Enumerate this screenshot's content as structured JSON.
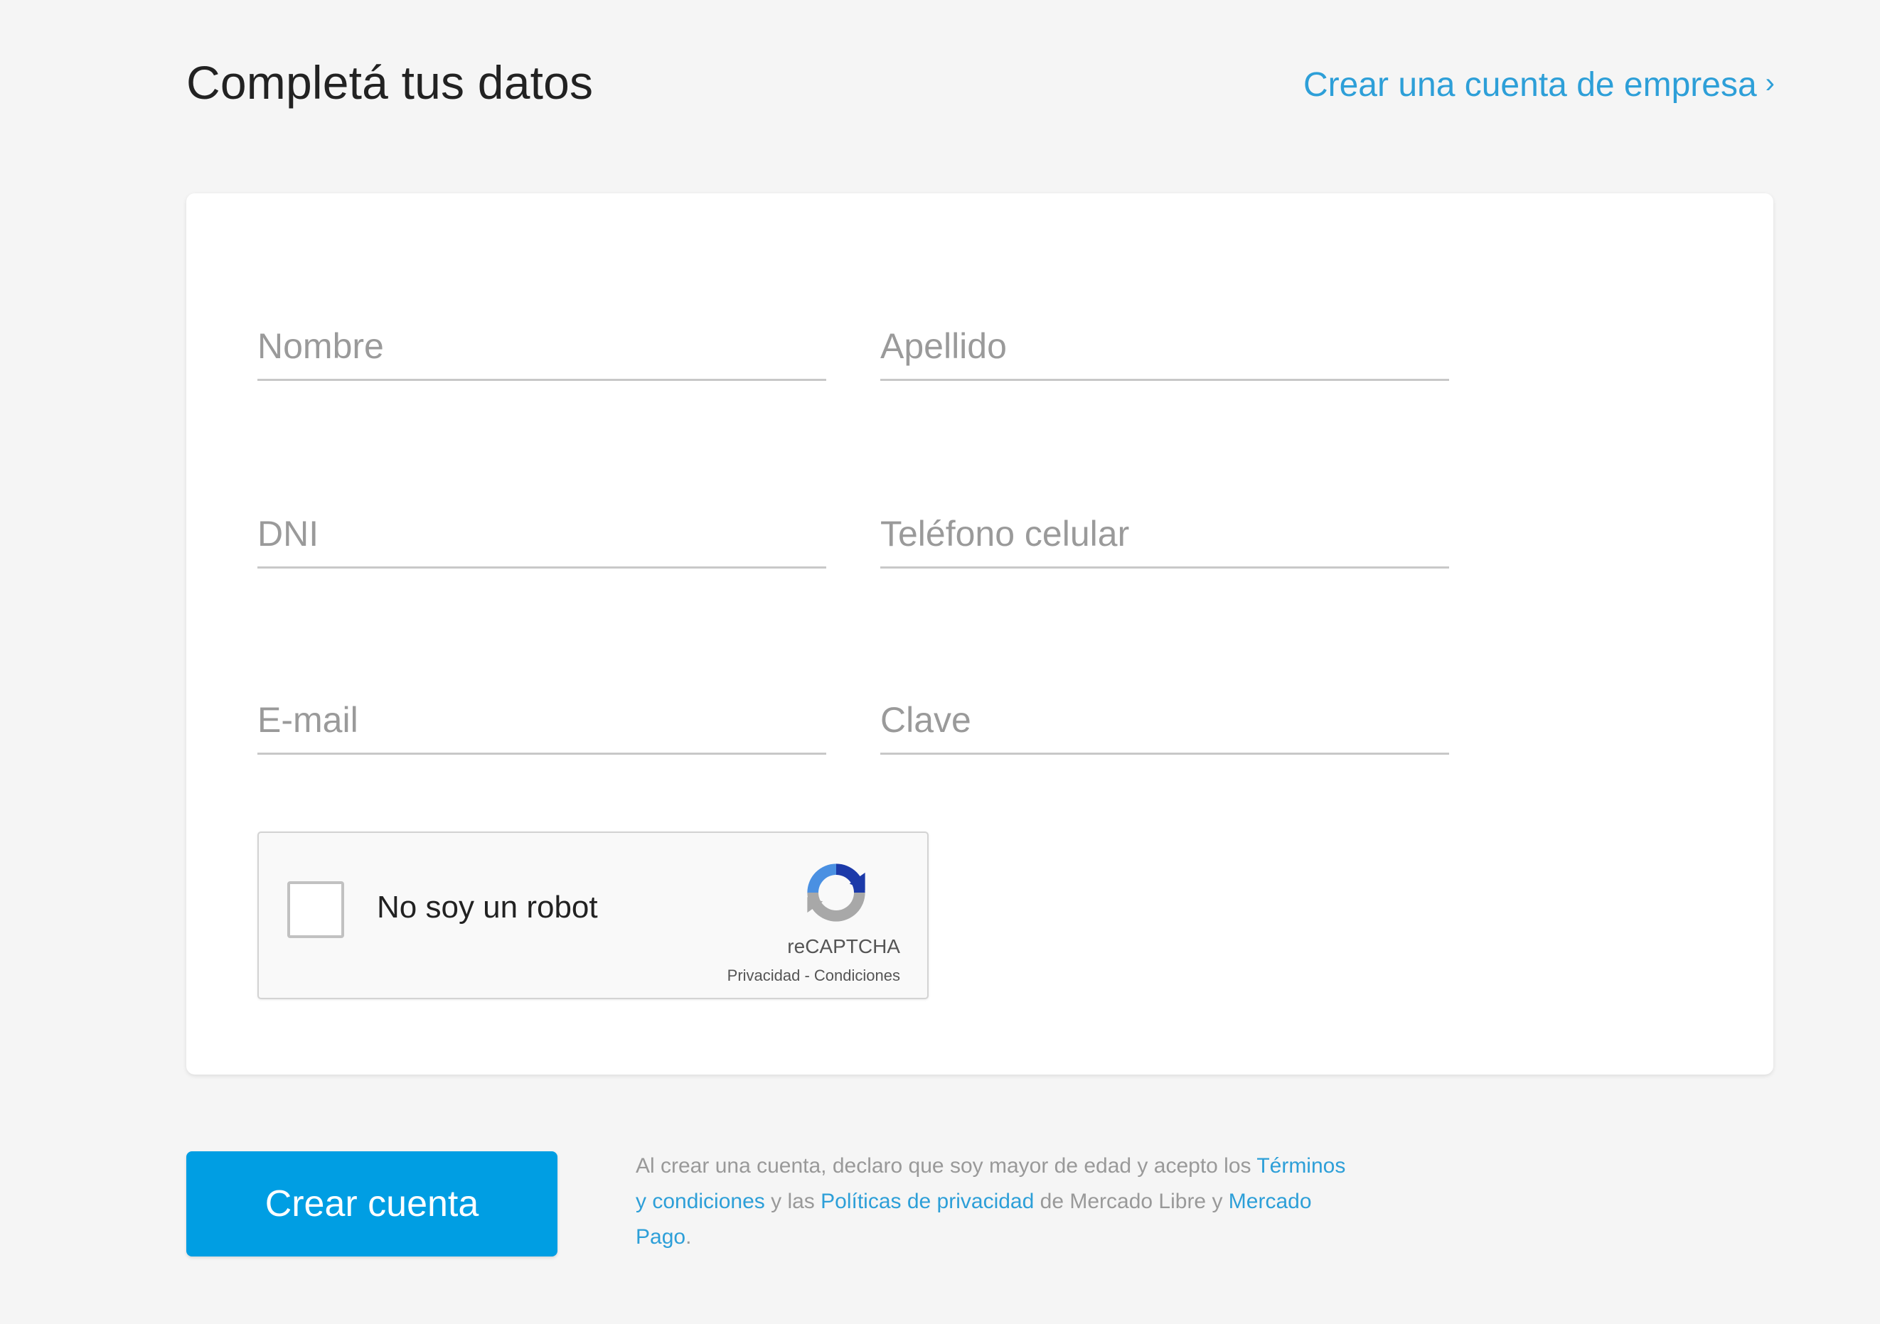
{
  "header": {
    "title": "Completá tus datos",
    "company_link": "Crear una cuenta de empresa",
    "company_link_chevron": "›"
  },
  "form": {
    "first_name": {
      "placeholder": "Nombre",
      "value": ""
    },
    "last_name": {
      "placeholder": "Apellido",
      "value": ""
    },
    "dni": {
      "placeholder": "DNI",
      "value": ""
    },
    "phone": {
      "placeholder": "Teléfono celular",
      "value": ""
    },
    "email": {
      "placeholder": "E-mail",
      "value": ""
    },
    "password": {
      "placeholder": "Clave",
      "value": ""
    }
  },
  "recaptcha": {
    "label": "No soy un robot",
    "brand": "reCAPTCHA",
    "privacy": "Privacidad",
    "separator": " - ",
    "terms": "Condiciones",
    "checked": false
  },
  "submit": {
    "label": "Crear cuenta"
  },
  "legal": {
    "intro": "Al crear una cuenta, declaro que soy mayor de edad y acepto los ",
    "terms_link": "Términos y condiciones",
    "and_the": " y las ",
    "privacy_link": "Políticas de privacidad",
    "of_mercado": " de Mercado Libre y ",
    "mercado_pago_link": "Mercado Pago",
    "end": "."
  },
  "colors": {
    "background": "#f5f5f5",
    "card": "#ffffff",
    "link": "#2d9fd8",
    "button": "#009ee3",
    "title": "#222222",
    "placeholder": "#9a9a9a"
  }
}
